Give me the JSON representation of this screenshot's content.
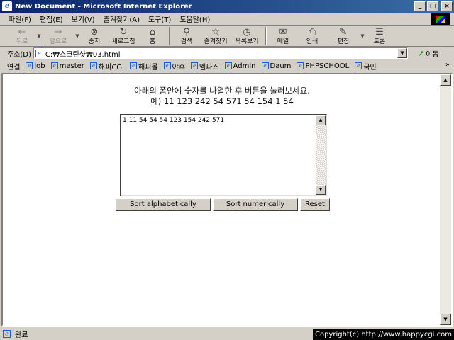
{
  "window": {
    "title": "New Document - Microsoft Internet Explorer",
    "min": "_",
    "max": "□",
    "close": "×"
  },
  "menu": [
    "파일(F)",
    "편집(E)",
    "보기(V)",
    "즐겨찾기(A)",
    "도구(T)",
    "도움말(H)"
  ],
  "toolbar": {
    "back": "뒤로",
    "forward": "앞으로",
    "stop": "중지",
    "refresh": "새로고침",
    "home": "홈",
    "search": "검색",
    "favorites": "즐겨찾기",
    "history": "목록보기",
    "mail": "메일",
    "print": "인쇄",
    "edit": "편집",
    "discuss": "토론"
  },
  "icons": {
    "back": "back-arrow-icon",
    "forward": "forward-arrow-icon",
    "stop": "stop-icon",
    "refresh": "refresh-icon",
    "home": "home-icon",
    "search": "search-icon",
    "favorites": "favorites-icon",
    "history": "history-icon",
    "mail": "mail-icon",
    "print": "printer-icon",
    "edit": "edit-icon",
    "discuss": "discuss-icon"
  },
  "address": {
    "label": "주소(D)",
    "value": "C:₩스크린샷₩03.html",
    "go": "이동"
  },
  "links": {
    "label": "연결",
    "items": [
      "job",
      "master",
      "해피CGI",
      "해피몰",
      "야후",
      "엠파스",
      "Admin",
      "Daum",
      "PHPSCHOOL",
      "국민"
    ],
    "more": "»"
  },
  "page": {
    "instruction_line1": "아래의 폼안에 숫자를 나열한 후 버튼을 눌러보세요.",
    "instruction_line2": "예) 11 123 242 54 571 54 154 1 54",
    "textarea_value": "1  11  54  54  54  123  154  242  571",
    "sort_alpha": "Sort alphabetically",
    "sort_num": "Sort numerically",
    "reset": "Reset"
  },
  "status": {
    "text": "완료",
    "copyright": "Copyright(c) http://www.happycgi.com"
  },
  "colors": {
    "titlebar_start": "#0a246a",
    "titlebar_end": "#3a6ea5",
    "chrome": "#d4d0c8"
  }
}
